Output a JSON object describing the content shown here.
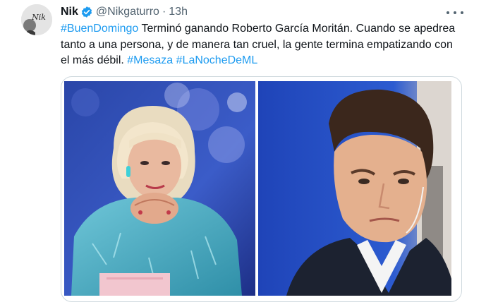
{
  "tweet": {
    "author_name": "Nik",
    "handle": "@Nikgaturro",
    "separator": "·",
    "time": "13h",
    "avatar_text": "Nik",
    "text": {
      "hashtag1": "#BuenDomingo",
      "body": " Terminó ganando Roberto García Moritán. Cuando se apedrea tanto a una persona, y de manera tan cruel, la gente termina empatizando con el más débil. ",
      "hashtag2": "#Mesaza",
      "hashtag3": "#LaNocheDeML"
    }
  },
  "icons": {
    "verified": "verified-badge-icon",
    "more": "more-options-icon"
  },
  "colors": {
    "hashtag": "#1d9bf0",
    "verified": "#1d9bf0",
    "secondary_text": "#536471",
    "border": "#cfd9de"
  }
}
